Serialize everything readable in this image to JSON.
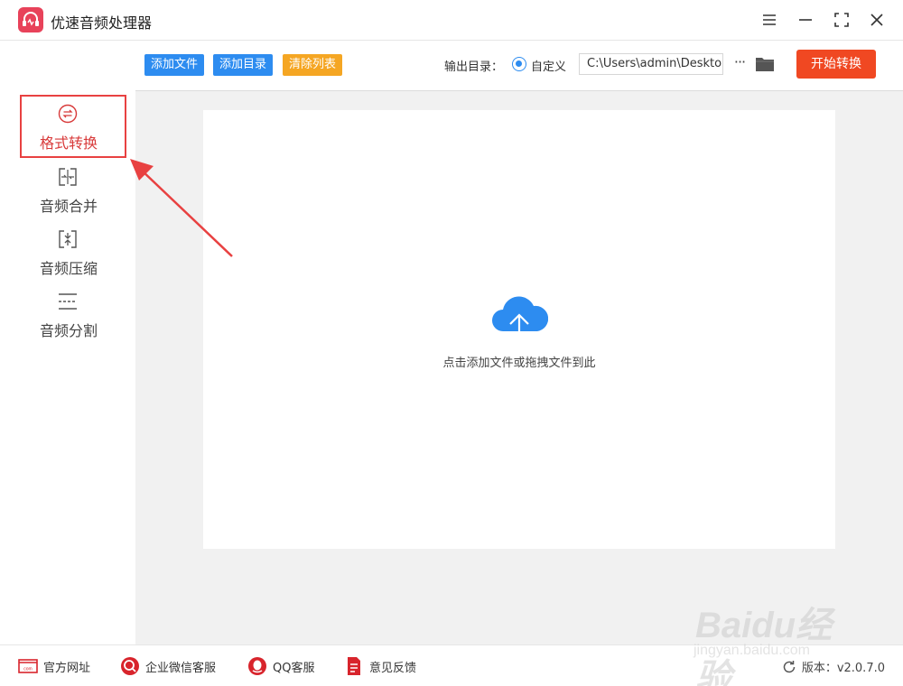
{
  "app": {
    "title": "优速音频处理器"
  },
  "colors": {
    "accent_blue": "#2d8cf0",
    "accent_orange": "#f5a623",
    "start_red": "#f04822",
    "active_red": "#d83a3a",
    "logo_pink": "#e8425a"
  },
  "window_controls": {
    "menu_icon": "menu-icon",
    "minimize_icon": "minimize-icon",
    "maximize_icon": "maximize-icon",
    "close_icon": "close-icon"
  },
  "sidebar": {
    "items": [
      {
        "label": "格式转换",
        "icon": "format-convert-icon",
        "active": true
      },
      {
        "label": "音频合并",
        "icon": "audio-merge-icon",
        "active": false
      },
      {
        "label": "音频压缩",
        "icon": "audio-compress-icon",
        "active": false
      },
      {
        "label": "音频分割",
        "icon": "audio-split-icon",
        "active": false
      }
    ]
  },
  "toolbar": {
    "add_file": "添加文件",
    "add_folder": "添加目录",
    "clear_list": "清除列表",
    "output_label": "输出目录：",
    "custom_option": "自定义",
    "output_path": "C:\\Users\\admin\\Deskto",
    "more": "···",
    "start": "开始转换"
  },
  "dropzone": {
    "hint": "点击添加文件或拖拽文件到此"
  },
  "footer": {
    "website": "官方网址",
    "wechat": "企业微信客服",
    "qq": "QQ客服",
    "feedback": "意见反馈",
    "version": "版本：v2.0.7.0"
  },
  "watermark": {
    "brand": "Baidu经验",
    "url": "jingyan.baidu.com"
  }
}
